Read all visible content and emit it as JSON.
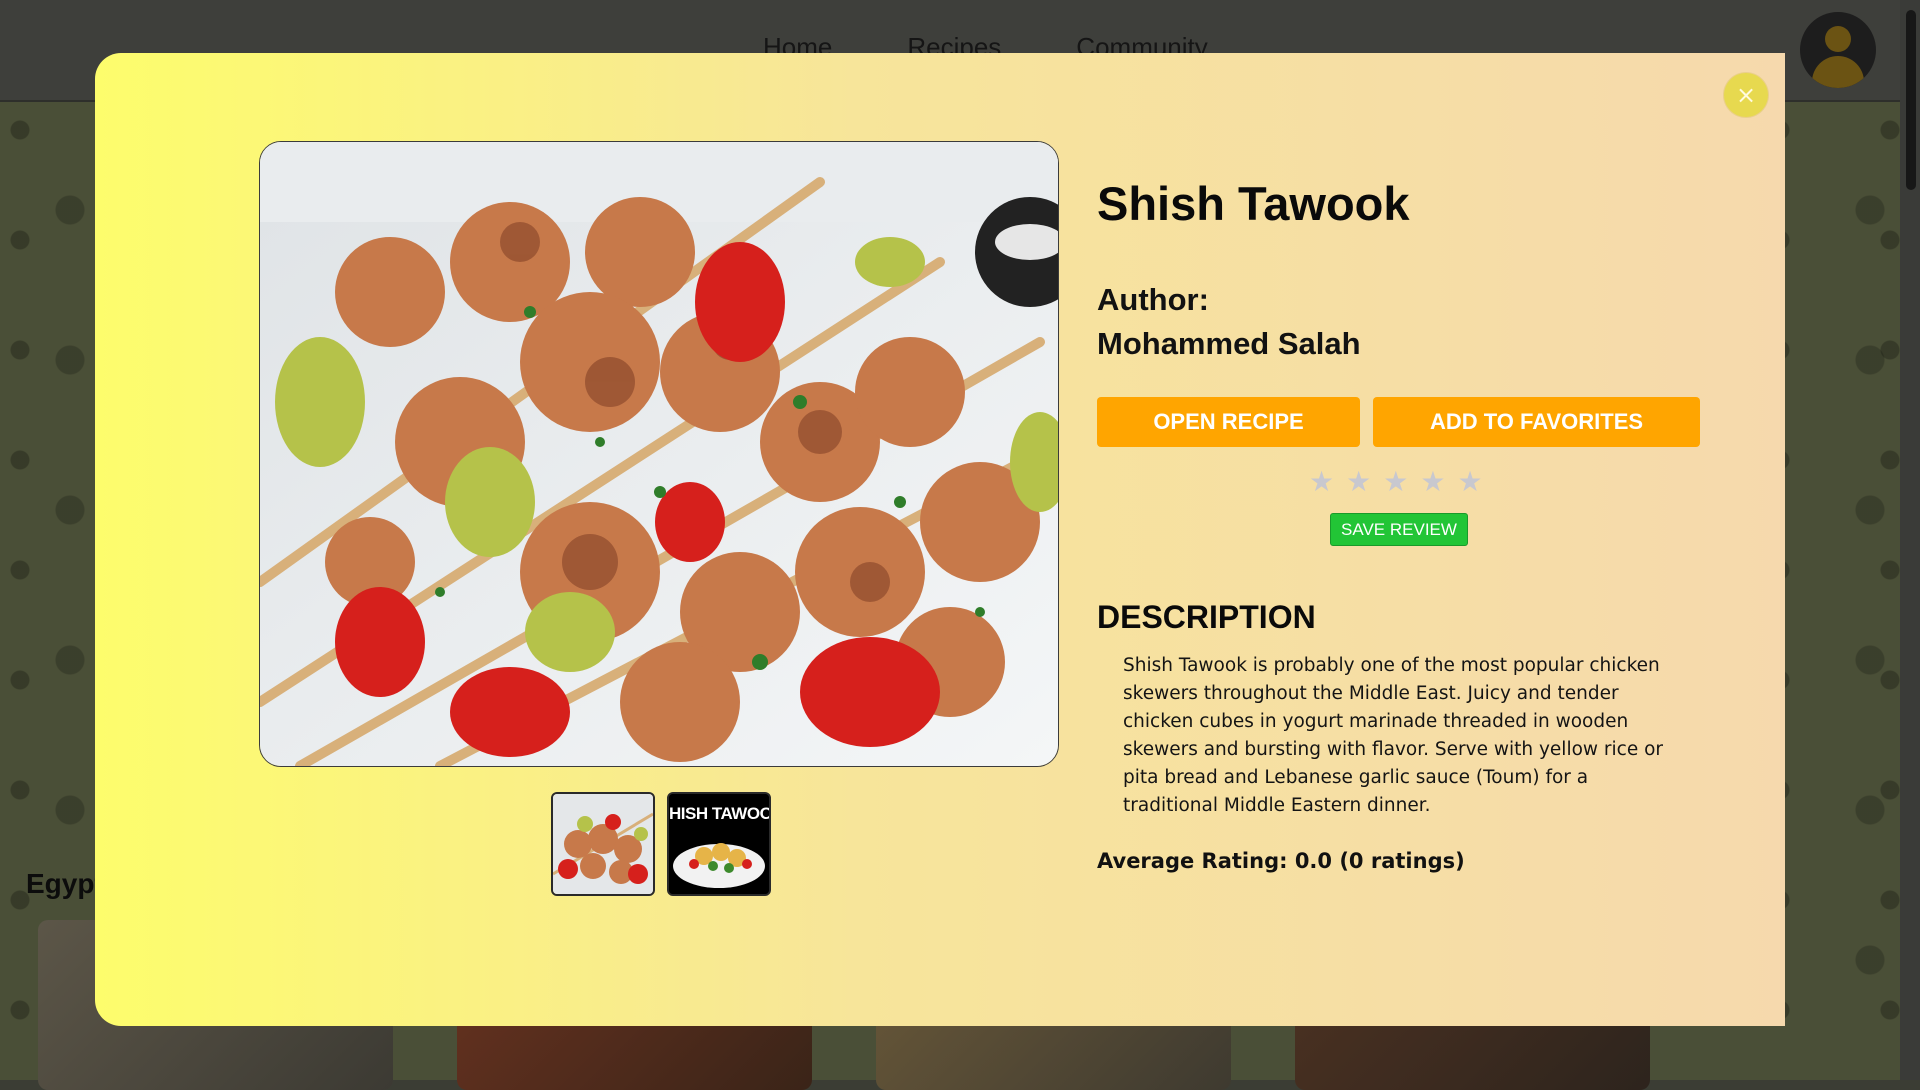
{
  "background": {
    "nav": [
      "Home",
      "Recipes",
      "Community"
    ],
    "section_title": "Egypt",
    "avatar_icon": "user-avatar-icon"
  },
  "modal": {
    "close_label": "×",
    "recipe": {
      "title": "Shish Tawook",
      "author_label": "Author:",
      "author_name": "Mohammed Salah",
      "open_recipe_label": "OPEN RECIPE",
      "add_favorites_label": "ADD TO FAVORITES",
      "rating_stars": 5,
      "star_glyph": "★",
      "save_review_label": "SAVE REVIEW",
      "description_heading": "DESCRIPTION",
      "description": "Shish Tawook is probably one of the most popular chicken skewers throughout the Middle East. Juicy and tender chicken cubes in yogurt marinade threaded in wooden skewers and bursting with flavor. Serve with yellow rice or pita bread and Lebanese garlic sauce (Toum) for a traditional Middle Eastern dinner.",
      "average_rating": "Average Rating: 0.0 (0 ratings)",
      "thumbnail_2_text": "HISH TAWOO"
    },
    "colors": {
      "accent_orange": "#ffa500",
      "save_green": "#22c536",
      "gradient_start": "#fdfd6c",
      "gradient_end": "#f6d9ad"
    }
  }
}
